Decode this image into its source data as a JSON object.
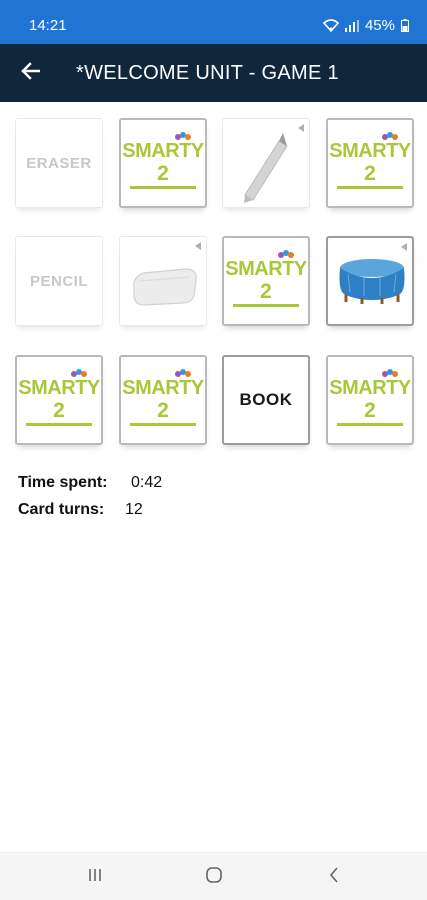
{
  "status": {
    "time": "14:21",
    "battery": "45%"
  },
  "app_bar": {
    "title": "*WELCOME UNIT - GAME 1"
  },
  "cards": {
    "eraser_word": "ERASER",
    "pencil_word": "PENCIL",
    "book_word": "BOOK",
    "logo_line1": "SMARTY",
    "logo_line2": "2"
  },
  "stats": {
    "time_label": "Time spent:",
    "time_value": "0:42",
    "turns_label": "Card turns:",
    "turns_value": "12"
  },
  "colors": {
    "status_bar": "#1f74d4",
    "app_bar": "#10263a",
    "logo_green": "#a8c83a"
  }
}
